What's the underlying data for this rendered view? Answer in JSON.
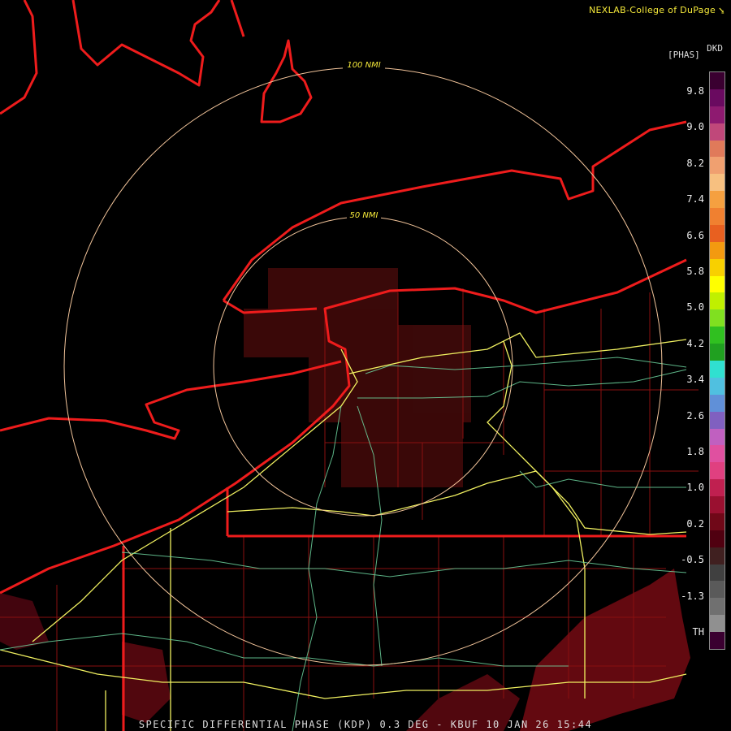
{
  "header": {
    "credit": "NEXLAB-College of DuPage"
  },
  "legend": {
    "product_code": "DKD",
    "units": "[PHAS]",
    "labels": [
      "9.8",
      "9.0",
      "8.2",
      "7.4",
      "6.6",
      "5.8",
      "5.0",
      "4.2",
      "3.4",
      "2.6",
      "1.8",
      "1.0",
      "0.2",
      "-0.5",
      "-1.3",
      "TH"
    ],
    "colors": [
      "#3a0030",
      "#6a0a60",
      "#8e1a70",
      "#c0487a",
      "#e07a5a",
      "#f0a070",
      "#f7c080",
      "#f5a040",
      "#f08030",
      "#e86020",
      "#f39a10",
      "#f8d000",
      "#ffff00",
      "#c0f000",
      "#80e020",
      "#30c020",
      "#20a020",
      "#30e0d0",
      "#50c0e0",
      "#6090d8",
      "#8060c0",
      "#c060c0",
      "#e050a0",
      "#e04080",
      "#c02050",
      "#9a1030",
      "#700818",
      "#500010",
      "#402020",
      "#404040",
      "#5a5a5a",
      "#707070",
      "#909090",
      "#3a0030"
    ]
  },
  "range_rings": {
    "inner_label": "50 NMI",
    "outer_label": "100 NMI"
  },
  "footer": {
    "caption": "SPECIFIC DIFFERENTIAL PHASE (KDP) 0.3 DEG - KBUF 10 JAN 26 15:44"
  }
}
